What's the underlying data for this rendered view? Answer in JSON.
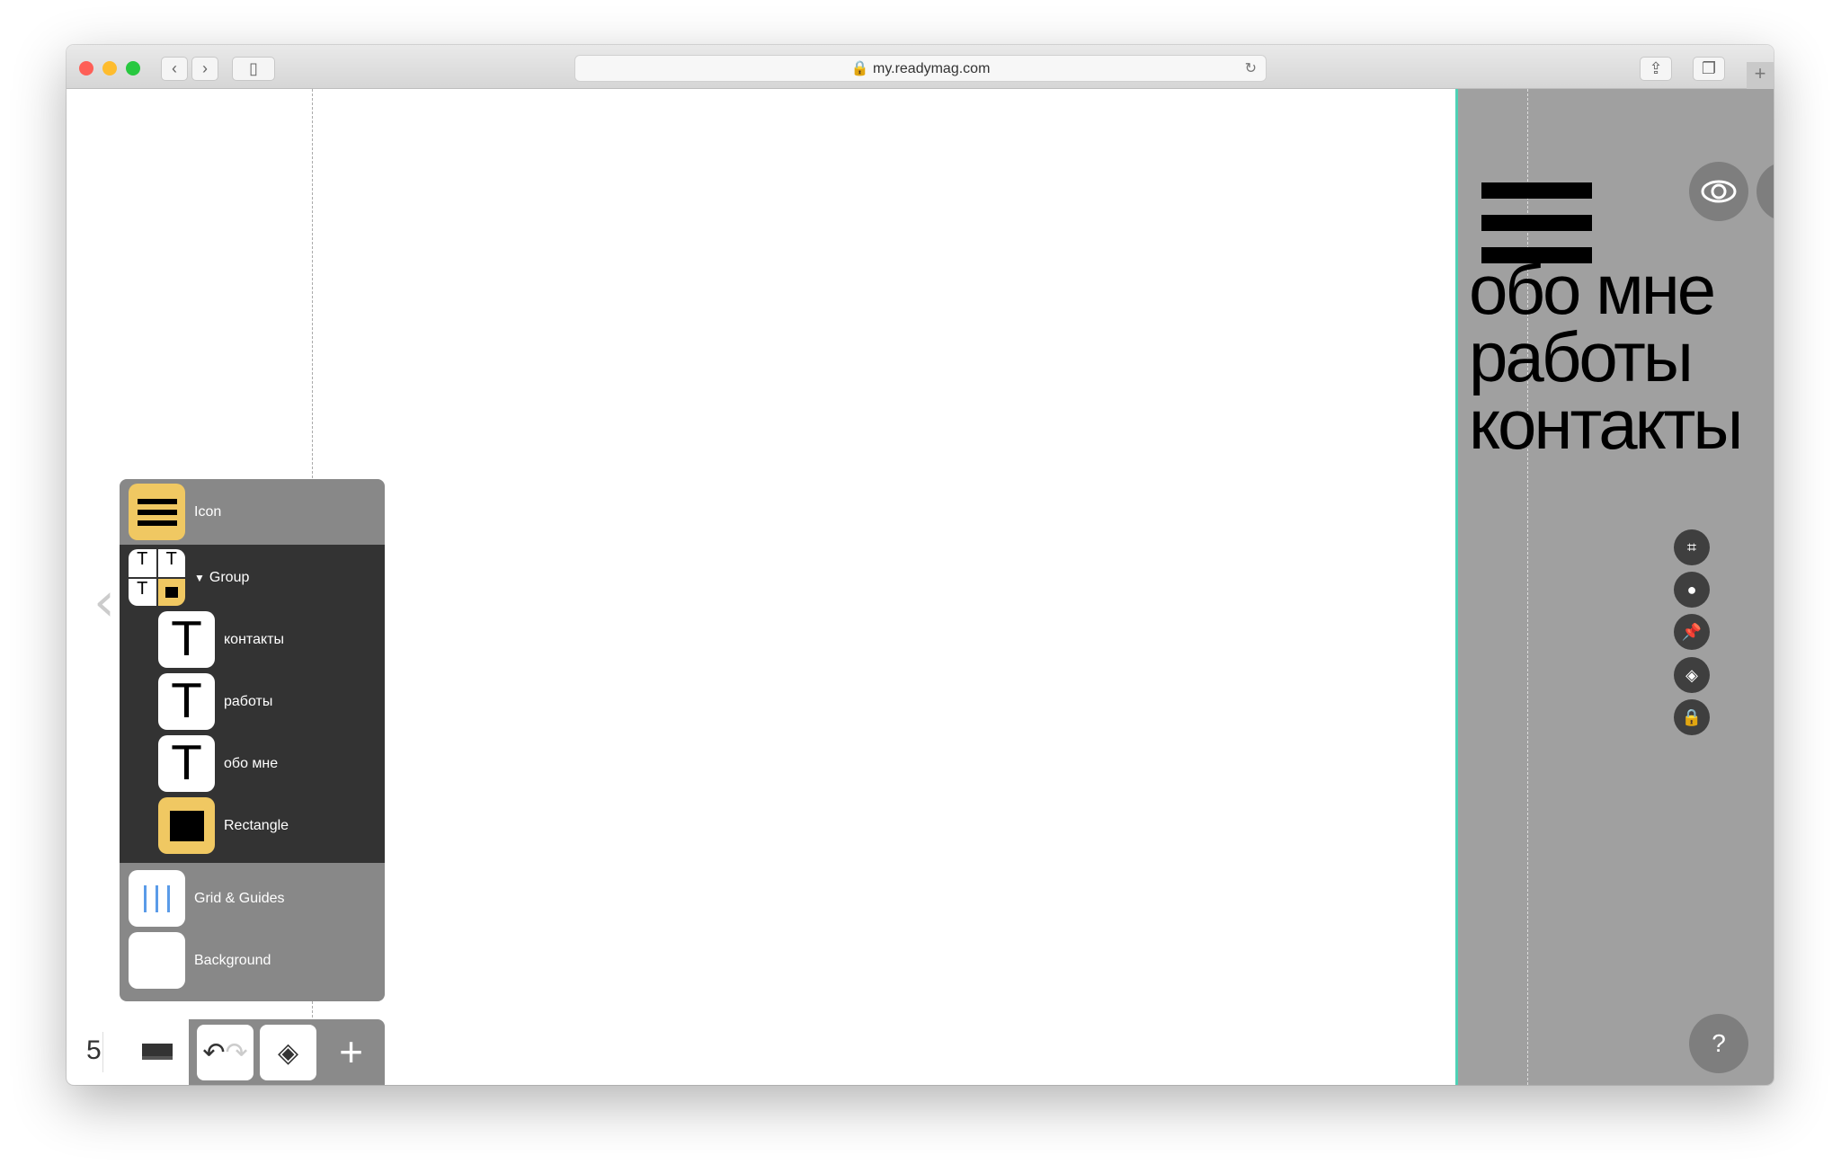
{
  "browser": {
    "url": "my.readymag.com"
  },
  "page": {
    "nav_items": [
      "обо мне",
      "работы",
      "контакты"
    ]
  },
  "layers": {
    "top": "Icon",
    "group": "Group",
    "children": [
      "контакты",
      "работы",
      "обо мне",
      "Rectangle"
    ],
    "grid": "Grid & Guides",
    "background": "Background"
  },
  "toolbar": {
    "page_number": "5"
  },
  "help": {
    "label": "?"
  },
  "colors": {
    "accent": "#f0c862",
    "panel_dark": "#333333",
    "right_bg": "#a0a0a0",
    "guide_border": "#4fd1b5"
  }
}
